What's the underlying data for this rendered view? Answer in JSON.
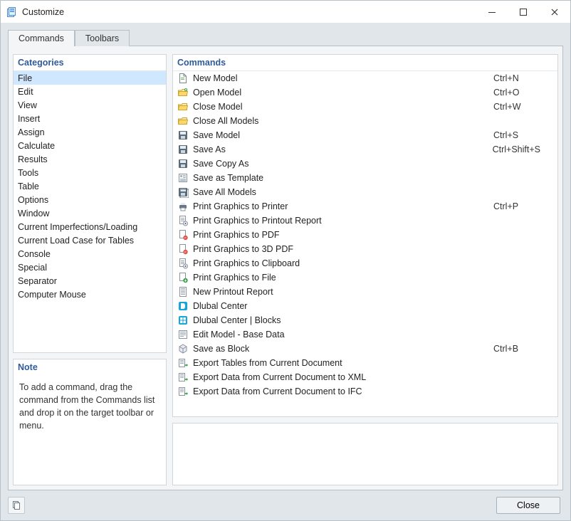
{
  "window": {
    "title": "Customize"
  },
  "tabs": {
    "commands": "Commands",
    "toolbars": "Toolbars"
  },
  "panels": {
    "categories_hdr": "Categories",
    "commands_hdr": "Commands",
    "note_hdr": "Note",
    "note_body": "To add a command, drag the command from the Commands list and drop it on the target toolbar or menu."
  },
  "categories": [
    {
      "label": "File",
      "selected": true
    },
    {
      "label": "Edit"
    },
    {
      "label": "View"
    },
    {
      "label": "Insert"
    },
    {
      "label": "Assign"
    },
    {
      "label": "Calculate"
    },
    {
      "label": "Results"
    },
    {
      "label": "Tools"
    },
    {
      "label": "Table"
    },
    {
      "label": "Options"
    },
    {
      "label": "Window"
    },
    {
      "label": "Current Imperfections/Loading"
    },
    {
      "label": "Current Load Case for Tables"
    },
    {
      "label": "Console"
    },
    {
      "label": "Special"
    },
    {
      "label": "Separator"
    },
    {
      "label": "Computer Mouse"
    }
  ],
  "commands": [
    {
      "icon": "file",
      "label": "New Model",
      "shortcut": "Ctrl+N"
    },
    {
      "icon": "folder-open",
      "label": "Open Model",
      "shortcut": "Ctrl+O"
    },
    {
      "icon": "folder-close",
      "label": "Close Model",
      "shortcut": "Ctrl+W"
    },
    {
      "icon": "folder-close-all",
      "label": "Close All Models",
      "shortcut": ""
    },
    {
      "icon": "save",
      "label": "Save Model",
      "shortcut": "Ctrl+S"
    },
    {
      "icon": "save",
      "label": "Save As",
      "shortcut": "Ctrl+Shift+S"
    },
    {
      "icon": "save-copy",
      "label": "Save Copy As",
      "shortcut": ""
    },
    {
      "icon": "template",
      "label": "Save as Template",
      "shortcut": ""
    },
    {
      "icon": "save-all",
      "label": "Save All Models",
      "shortcut": ""
    },
    {
      "icon": "printer",
      "label": "Print Graphics to Printer",
      "shortcut": "Ctrl+P"
    },
    {
      "icon": "print-report",
      "label": "Print Graphics to Printout Report",
      "shortcut": ""
    },
    {
      "icon": "print-pdf",
      "label": "Print Graphics to PDF",
      "shortcut": ""
    },
    {
      "icon": "print-3dpdf",
      "label": "Print Graphics to 3D PDF",
      "shortcut": ""
    },
    {
      "icon": "print-clip",
      "label": "Print Graphics to Clipboard",
      "shortcut": ""
    },
    {
      "icon": "print-file",
      "label": "Print Graphics to File",
      "shortcut": ""
    },
    {
      "icon": "report",
      "label": "New Printout Report",
      "shortcut": ""
    },
    {
      "icon": "dlubal",
      "label": "Dlubal Center",
      "shortcut": ""
    },
    {
      "icon": "dlubal-blocks",
      "label": "Dlubal Center | Blocks",
      "shortcut": ""
    },
    {
      "icon": "edit-data",
      "label": "Edit Model - Base Data",
      "shortcut": ""
    },
    {
      "icon": "block",
      "label": "Save as Block",
      "shortcut": "Ctrl+B"
    },
    {
      "icon": "export",
      "label": "Export Tables from Current Document",
      "shortcut": ""
    },
    {
      "icon": "export-xml",
      "label": "Export Data from Current Document to XML",
      "shortcut": ""
    },
    {
      "icon": "export-ifc",
      "label": "Export Data from Current Document to IFC",
      "shortcut": ""
    }
  ],
  "footer": {
    "close": "Close"
  }
}
